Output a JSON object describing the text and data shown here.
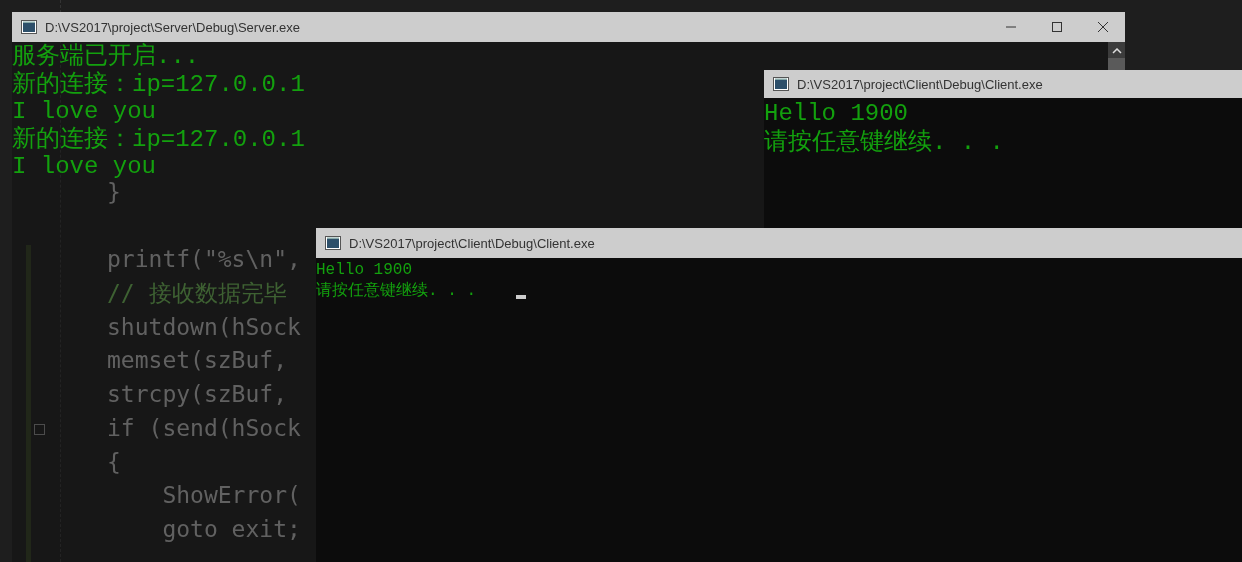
{
  "editor": {
    "blocks": [
      {
        "lines": [
          {
            "text": "}",
            "kind": "code"
          }
        ]
      },
      {
        "lines": [
          {
            "text": "printf(\"%s\\n\",",
            "kind": "code"
          },
          {
            "text": "// 接收数据完毕",
            "kind": "comment"
          },
          {
            "text": "shutdown(hSock",
            "kind": "code"
          },
          {
            "text": "memset(szBuf,",
            "kind": "code"
          },
          {
            "text": "strcpy(szBuf,",
            "kind": "code"
          },
          {
            "text": "if (send(hSock",
            "kind": "code"
          },
          {
            "text": "{",
            "kind": "code"
          },
          {
            "text": "    ShowError(",
            "kind": "code"
          },
          {
            "text": "    goto exit;",
            "kind": "code"
          }
        ]
      }
    ]
  },
  "windows": [
    {
      "title": "D:\\VS2017\\project\\Server\\Debug\\Server.exe",
      "caption_buttons": true,
      "scrollbar": true,
      "cursor": false,
      "output": [
        "服务端已开启...",
        "新的连接：ip=127.0.0.1",
        "I love you",
        "新的连接：ip=127.0.0.1",
        "I love you"
      ]
    },
    {
      "title": "D:\\VS2017\\project\\Client\\Debug\\Client.exe",
      "caption_buttons": false,
      "scrollbar": false,
      "cursor": false,
      "output": [
        "Hello 1900",
        "请按任意键继续. . ."
      ]
    },
    {
      "title": "D:\\VS2017\\project\\Client\\Debug\\Client.exe",
      "caption_buttons": false,
      "scrollbar": false,
      "cursor": true,
      "output": [
        "Hello 1900",
        "请按任意键继续. . ."
      ]
    }
  ]
}
